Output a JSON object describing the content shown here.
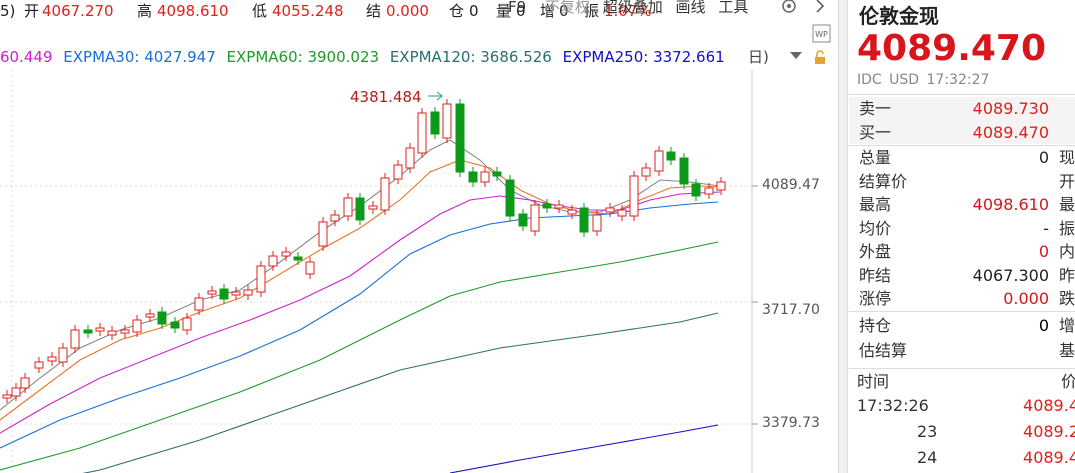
{
  "toolbar": {
    "prefix": "5)",
    "open_label": "开",
    "open_value": "4067.270",
    "high_label": "高",
    "high_value": "4098.610",
    "low_label": "低",
    "low_value": "4055.248",
    "settle_label": "结",
    "settle_value": "0.000",
    "position_label": "仓",
    "position_value": "0",
    "volume_label": "量",
    "volume_value": "0",
    "increase_label": "增",
    "increase_value": "0",
    "amplitude_label": "振",
    "amplitude_value": "1.07%",
    "f9": "F9",
    "no_adjust": "不复权",
    "overlay": "超级叠加",
    "draw": "画线",
    "tools": "工具",
    "right_paren": "日)"
  },
  "ma_legend": [
    {
      "text": "60.449",
      "color": "#cc22cc"
    },
    {
      "text": "EXPMA30: 4027.947",
      "color": "#1a6fd8"
    },
    {
      "text": "EXPMA60: 3900.023",
      "color": "#1f9a2a"
    },
    {
      "text": "EXPMA120: 3686.526",
      "color": "#2b6f6f"
    },
    {
      "text": "EXPMA250: 3372.661",
      "color": "#1010c8"
    }
  ],
  "chart": {
    "peak_label": "4381.484",
    "y_labels": [
      "4089.47",
      "3717.70",
      "3379.73"
    ],
    "y_values": [
      4089.47,
      3717.7,
      3379.73
    ],
    "colors": {
      "up": "#e0201b",
      "down": "#0d9a1b",
      "ma5": "#888888",
      "ma10": "#e8752a",
      "ma20": "#cc22cc",
      "ma30": "#1a6fd8",
      "ma60": "#1f9a2a",
      "ma120": "#2b6f6f",
      "ma250": "#1010c8"
    }
  },
  "quote": {
    "name": "伦敦金现",
    "price": "4089.470",
    "exchange": "IDC",
    "currency": "USD",
    "time": "17:32:27",
    "sell_label": "卖一",
    "sell_value": "4089.730",
    "buy_label": "买一",
    "buy_value": "4089.470",
    "stats": [
      {
        "label": "总量",
        "value": "0",
        "extra": "现",
        "color": "#222222"
      },
      {
        "label": "结算价",
        "value": "",
        "extra": "开",
        "color": "#222222"
      },
      {
        "label": "最高",
        "value": "4098.610",
        "extra": "最",
        "color": "#d8151b"
      },
      {
        "label": "均价",
        "value": "-",
        "extra": "振",
        "color": "#222222"
      },
      {
        "label": "外盘",
        "value": "0",
        "extra": "内",
        "color": "#d8151b"
      },
      {
        "label": "昨结",
        "value": "4067.300",
        "extra": "昨",
        "color": "#222222"
      },
      {
        "label": "涨停",
        "value": "0.000",
        "extra": "跌",
        "color": "#d8151b"
      }
    ],
    "stats2": [
      {
        "label": "持仓",
        "value": "0",
        "extra": "增"
      },
      {
        "label": "估结算",
        "value": "",
        "extra": "基"
      }
    ],
    "ticks_header_time": "时间",
    "ticks_header_price": "价",
    "ticks": [
      {
        "time": "17:32:26",
        "price": "4089.4"
      },
      {
        "time": "23",
        "price": "4089.2"
      },
      {
        "time": "24",
        "price": "4089.4"
      }
    ]
  }
}
